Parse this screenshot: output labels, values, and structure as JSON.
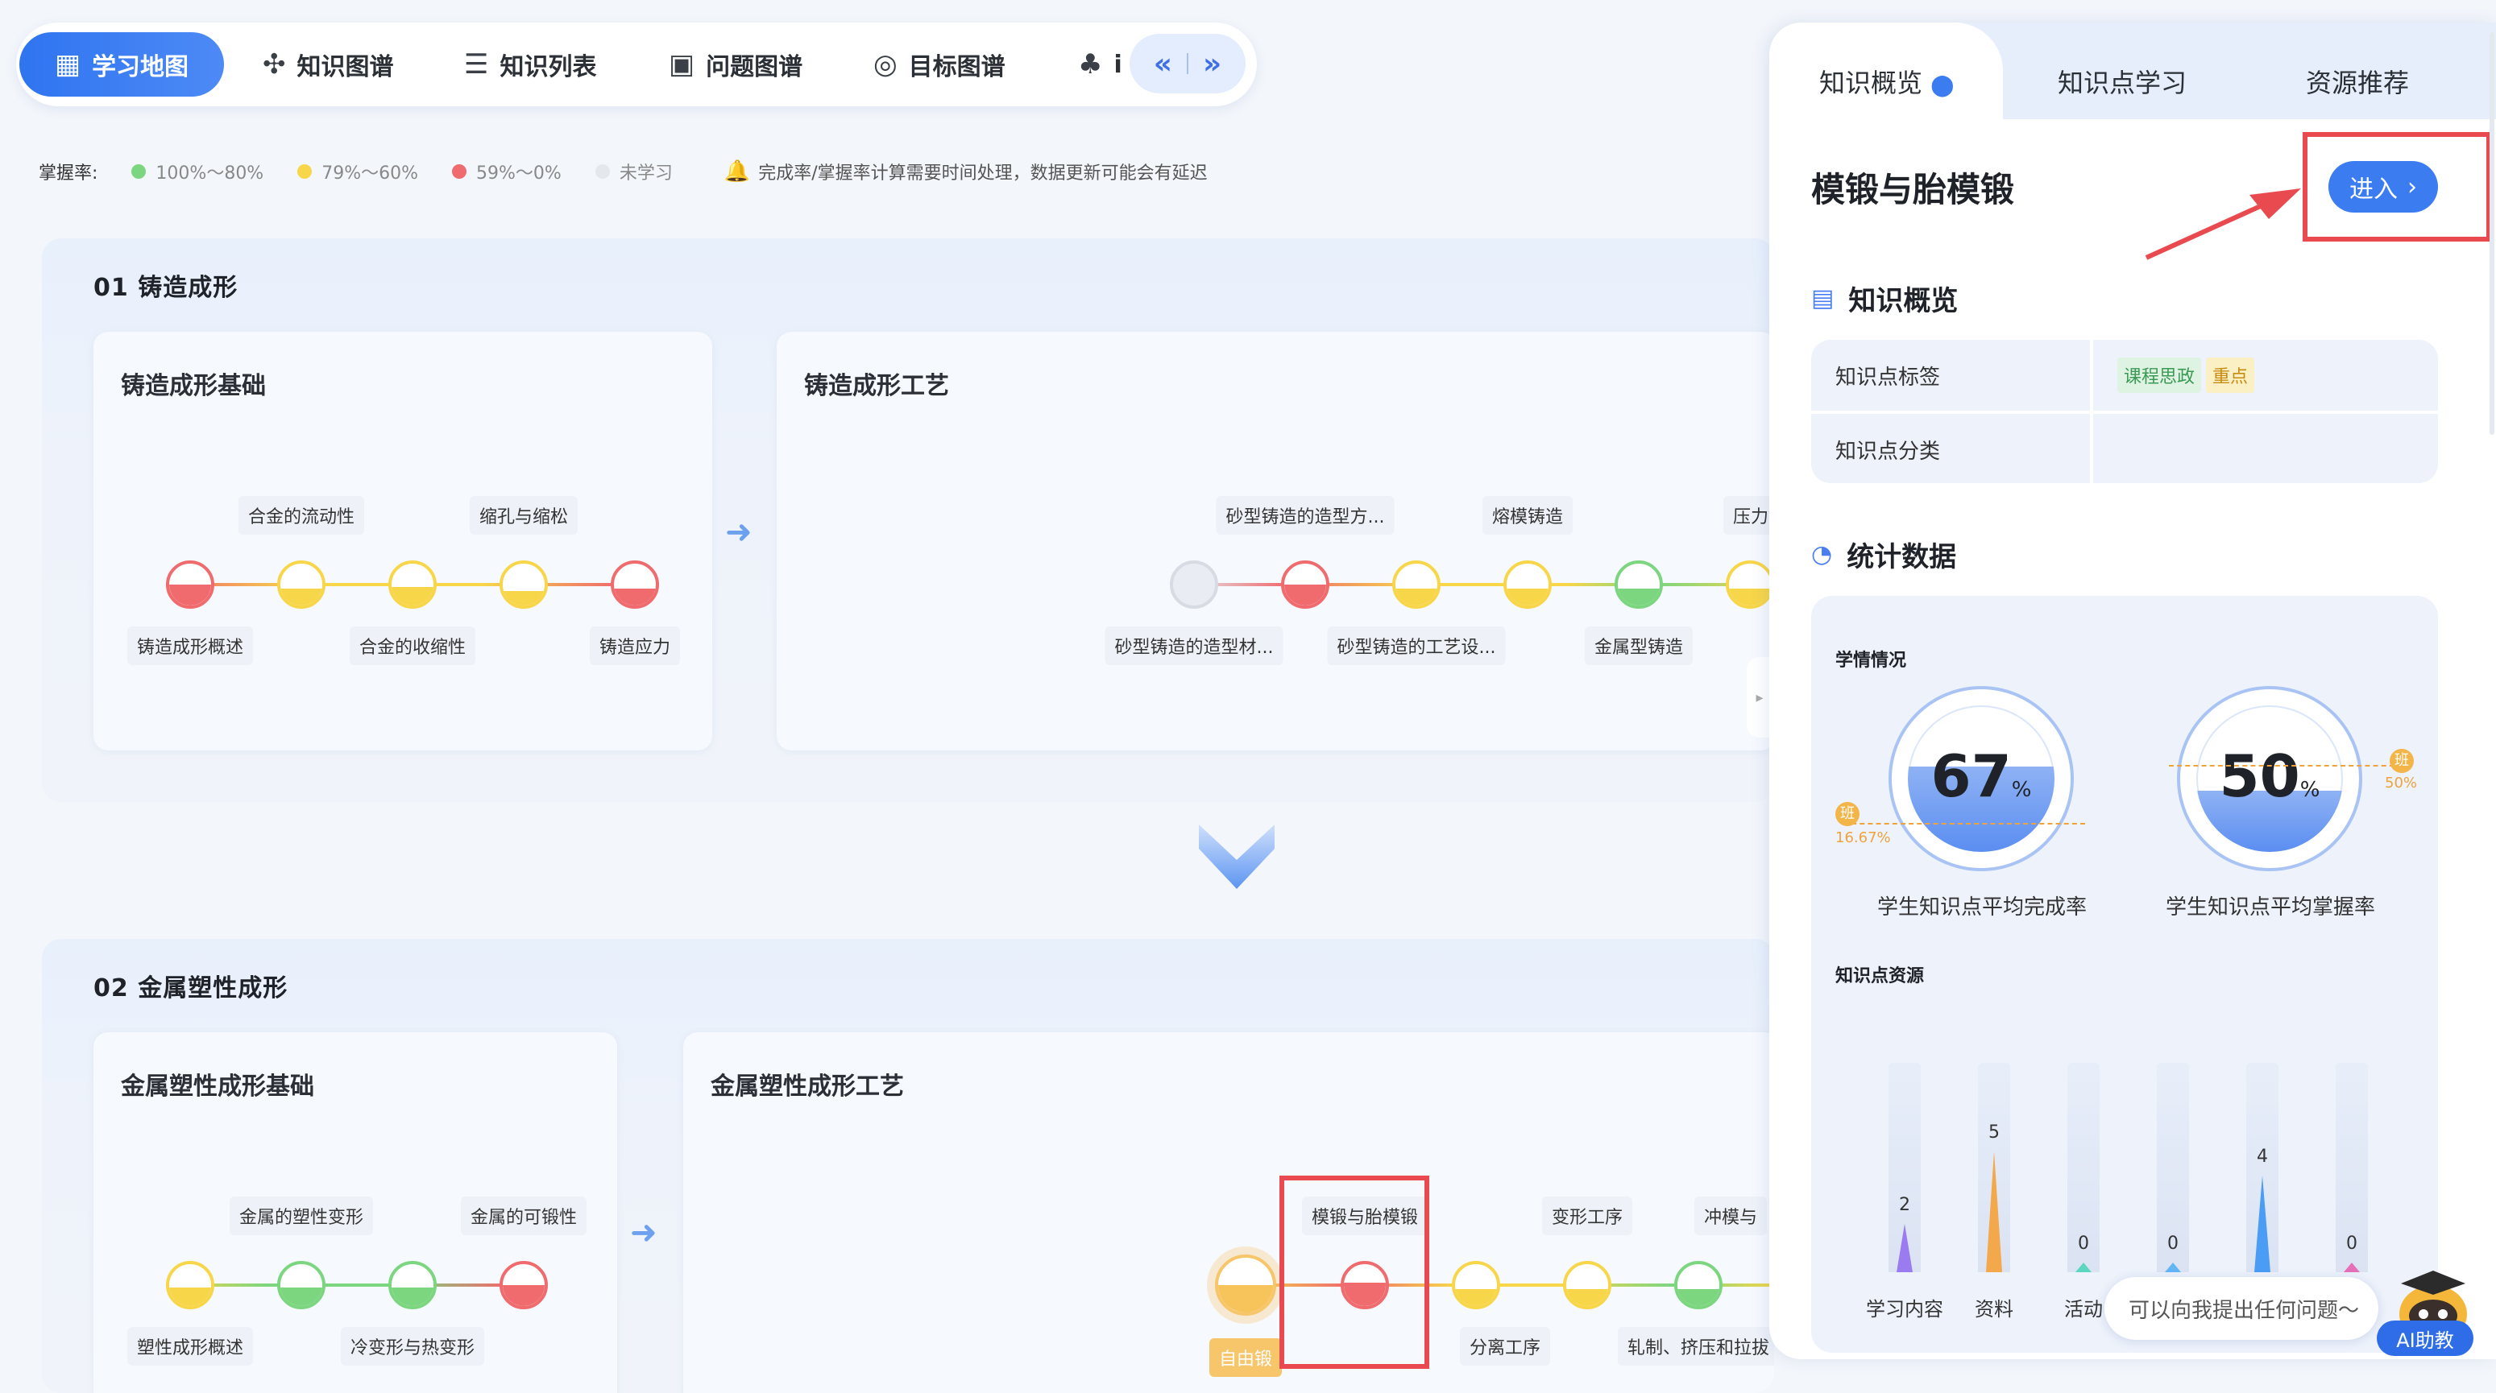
{
  "tabs": [
    {
      "label": "学习地图",
      "icon": "grid-icon"
    },
    {
      "label": "知识图谱",
      "icon": "graph-icon"
    },
    {
      "label": "知识列表",
      "icon": "list-icon"
    },
    {
      "label": "问题图谱",
      "icon": "question-icon"
    },
    {
      "label": "目标图谱",
      "icon": "target-icon"
    },
    {
      "label": "i",
      "icon": "club-icon"
    }
  ],
  "nav": {
    "prev": "«",
    "next": "»"
  },
  "legend": {
    "title": "掌握率:",
    "items": [
      {
        "label": "100%～80%",
        "color": "#7cd67f"
      },
      {
        "label": "79%～60%",
        "color": "#f7d64a"
      },
      {
        "label": "59%～0%",
        "color": "#ef6b6e"
      },
      {
        "label": "未学习",
        "color": "#e4e7ec"
      }
    ],
    "notice": "完成率/掌握率计算需要时间处理，数据更新可能会有延迟"
  },
  "sections": [
    {
      "title": "01  铸造成形",
      "cards": [
        {
          "title": "铸造成形基础",
          "top_labels": [
            "合金的流动性",
            "缩孔与缩松"
          ],
          "bottom_labels": [
            "铸造成形概述",
            "合金的收缩性",
            "铸造应力"
          ]
        },
        {
          "title": "铸造成形工艺",
          "top_labels": [
            "砂型铸造的造型方...",
            "熔模铸造",
            "压力铸"
          ],
          "bottom_labels": [
            "砂型铸造的造型材...",
            "砂型铸造的工艺设...",
            "金属型铸造"
          ]
        }
      ]
    },
    {
      "title": "02  金属塑性成形",
      "cards": [
        {
          "title": "金属塑性成形基础",
          "top_labels": [
            "金属的塑性变形",
            "金属的可锻性"
          ],
          "bottom_labels": [
            "塑性成形概述",
            "冷变形与热变形"
          ]
        },
        {
          "title": "金属塑性成形工艺",
          "top_labels": [
            "模锻与胎模锻",
            "变形工序",
            "冲模与"
          ],
          "bottom_labels": [
            "自由锻",
            "分离工序",
            "轧制、挤压和拉拔"
          ]
        }
      ]
    }
  ],
  "panel": {
    "tabs": [
      "知识概览",
      "知识点学习",
      "资源推荐"
    ],
    "title": "模锻与胎模锻",
    "enter_label": "进入",
    "overview_title": "知识概览",
    "table": [
      {
        "key": "知识点标签",
        "tags": [
          "课程思政",
          "重点"
        ]
      },
      {
        "key": "知识点分类",
        "tags": []
      }
    ],
    "stats_title": "统计数据",
    "study_title": "学情情况",
    "gauges": [
      {
        "value": "67",
        "unit": "%",
        "class_label": "班",
        "class_value": "16.67%",
        "caption": "学生知识点平均完成率"
      },
      {
        "value": "50",
        "unit": "%",
        "class_label": "班",
        "class_value": "50%",
        "caption": "学生知识点平均掌握率"
      }
    ],
    "resource_title": "知识点资源",
    "resources": [
      {
        "label": "学习内容",
        "value": 2,
        "color": "#9b7cf0"
      },
      {
        "label": "资料",
        "value": 5,
        "color": "#f3a94b"
      },
      {
        "label": "活动",
        "value": 0,
        "color": "#5bd6c0"
      },
      {
        "label": "",
        "value": 0,
        "color": "#62b6f4"
      },
      {
        "label": "",
        "value": 4,
        "color": "#4a9cf4"
      },
      {
        "label": "",
        "value": 0,
        "color": "#e66fb8"
      }
    ]
  },
  "ai": {
    "placeholder": "可以向我提出任何问题～",
    "label": "AI助教"
  }
}
